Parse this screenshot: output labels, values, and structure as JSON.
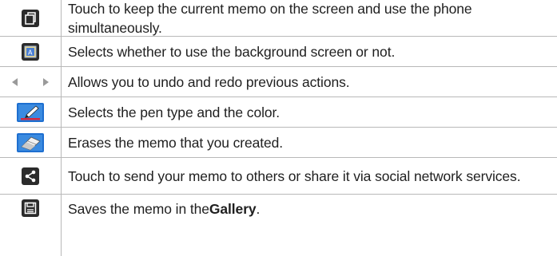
{
  "rows": [
    {
      "icon": "overlay-window-icon",
      "text": "Touch to keep the current memo on the screen and use the phone simultaneously."
    },
    {
      "icon": "background-screen-icon",
      "text": "Selects whether to use the background screen or not."
    },
    {
      "icon": "undo-redo-arrows-icon",
      "text": "Allows you to undo and redo previous actions."
    },
    {
      "icon": "pen-icon",
      "text": "Selects the pen type and the color."
    },
    {
      "icon": "eraser-icon",
      "text": "Erases the memo that you created."
    },
    {
      "icon": "share-icon",
      "text": "Touch to send your memo to others or share it via social network services."
    },
    {
      "icon": "save-icon",
      "text_before": "Saves the memo in the ",
      "text_bold": "Gallery",
      "text_after": "."
    }
  ],
  "colors": {
    "icon_tile_dark": "#2b2b2b",
    "icon_tile_blue": "#1e6fd0",
    "arrow_gray": "#9a9a9a",
    "pen_red": "#d7263d",
    "border": "#b8b8b8"
  }
}
